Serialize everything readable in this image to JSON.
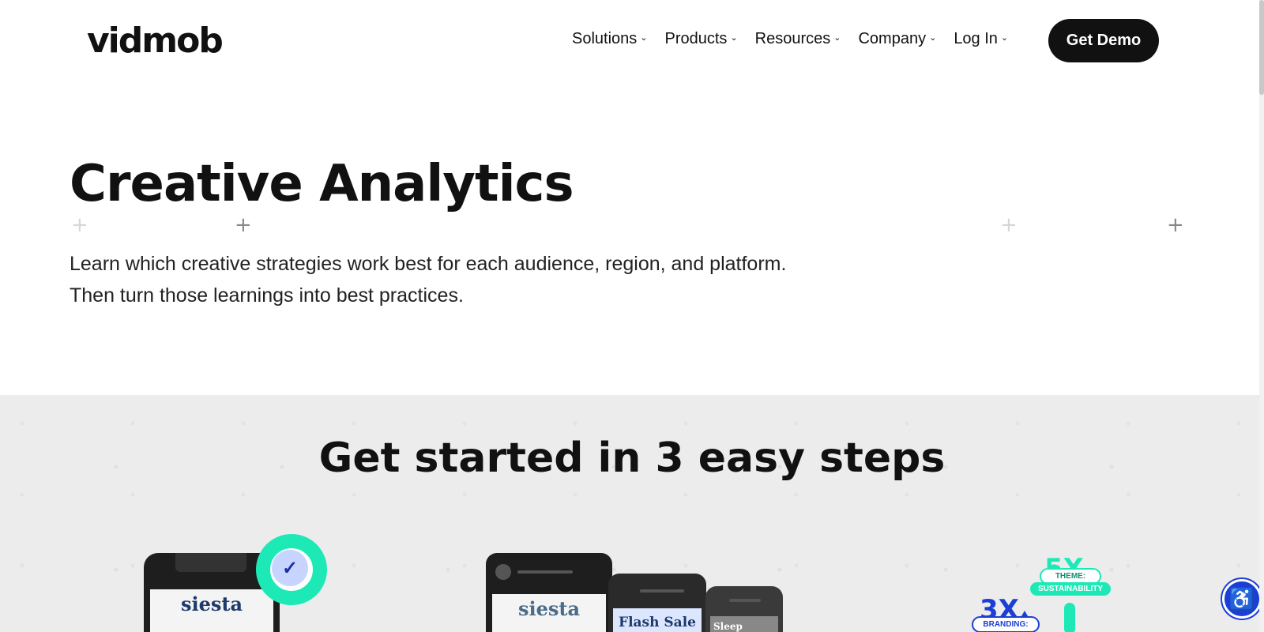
{
  "header": {
    "logo": "vidmob",
    "nav": [
      {
        "label": "Solutions"
      },
      {
        "label": "Products"
      },
      {
        "label": "Resources"
      },
      {
        "label": "Company"
      },
      {
        "label": "Log In"
      }
    ],
    "cta_label": "Get Demo",
    "chevron_icon": "chevron-down-icon"
  },
  "hero": {
    "title": "Creative Analytics",
    "subtitle_line1": "Learn which creative strategies work best for each audience, region, and platform.",
    "subtitle_line2": "Then turn those learnings into best practices."
  },
  "steps": {
    "title_plain": "Get started in ",
    "title_bold": "3 easy steps"
  },
  "illustrations": {
    "brand_1": "siesta",
    "brand_2": "siesta",
    "card_2_text": "Flash Sale",
    "card_3_text": "Sleep Better",
    "stat_a": "5X",
    "stat_a_label_1": "THEME:",
    "stat_a_label_2": "SUSTAINABILITY",
    "stat_b": "3X",
    "stat_b_label": "BRANDING:"
  },
  "colors": {
    "accent_green": "#1de9b6",
    "accent_blue": "#1b3fd6",
    "cta_bg": "#111111",
    "section_bg": "#ececec"
  },
  "accessibility_icon": "accessibility-icon"
}
